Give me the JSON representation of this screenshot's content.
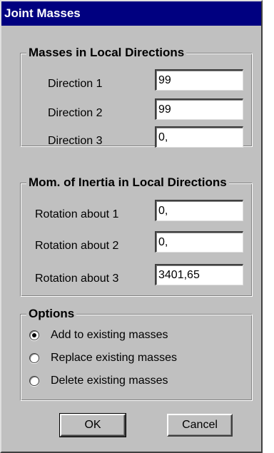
{
  "window": {
    "title": "Joint Masses"
  },
  "masses_group": {
    "title": "Masses in Local Directions",
    "rows": [
      {
        "label": "Direction 1",
        "value": "99"
      },
      {
        "label": "Direction 2",
        "value": "99"
      },
      {
        "label": "Direction 3",
        "value": "0,"
      }
    ]
  },
  "inertia_group": {
    "title": "Mom. of Inertia in Local Directions",
    "rows": [
      {
        "label": "Rotation about 1",
        "value": "0,"
      },
      {
        "label": "Rotation about 2",
        "value": "0,"
      },
      {
        "label": "Rotation about 3",
        "value": "3401,65"
      }
    ]
  },
  "options_group": {
    "title": "Options",
    "selected": 0,
    "items": [
      {
        "label": "Add to existing masses"
      },
      {
        "label": "Replace existing masses"
      },
      {
        "label": "Delete existing masses"
      }
    ]
  },
  "buttons": {
    "ok": "OK",
    "cancel": "Cancel"
  }
}
